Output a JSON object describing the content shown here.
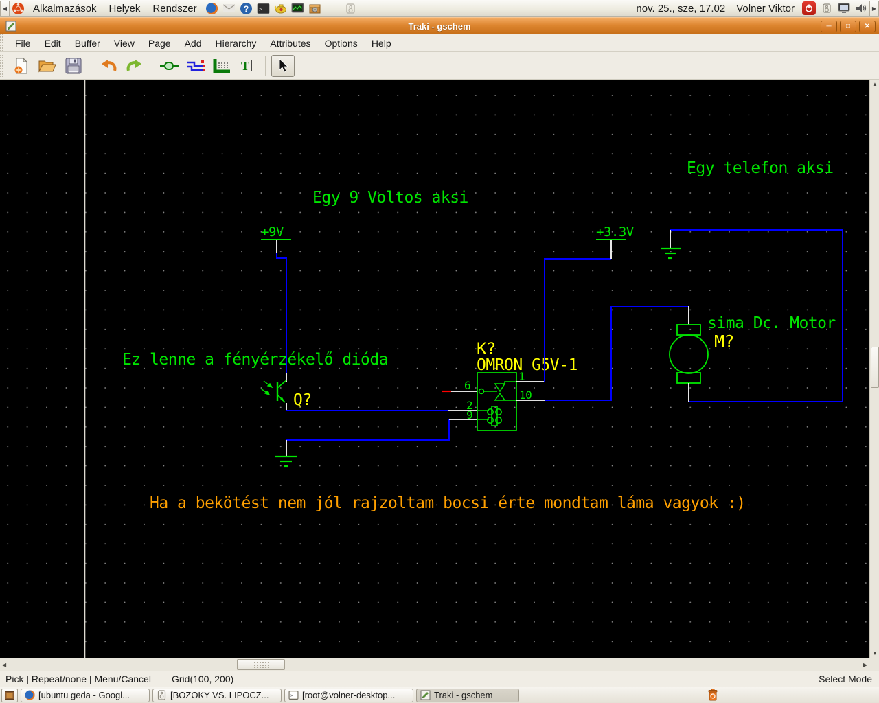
{
  "gnome_panel": {
    "menus": [
      "Alkalmazások",
      "Helyek",
      "Rendszer"
    ],
    "launcher_icons": [
      "firefox-icon",
      "mail-icon",
      "help-icon",
      "terminal-icon",
      "lamp-icon",
      "system-monitor-icon",
      "package-icon",
      "speaker-muted-icon"
    ],
    "clock": "nov. 25., sze, 17.02",
    "user": "Volner Viktor",
    "tray_icons": [
      "power-icon",
      "speaker-icon",
      "display-icon",
      "volume-icon"
    ]
  },
  "window": {
    "title": "Traki - gschem",
    "controls": {
      "minimize": "─",
      "maximize": "□",
      "close": "✕"
    }
  },
  "menubar": {
    "items": [
      "File",
      "Edit",
      "Buffer",
      "View",
      "Page",
      "Add",
      "Hierarchy",
      "Attributes",
      "Options",
      "Help"
    ]
  },
  "toolbar": {
    "icons": [
      "new-file-icon",
      "open-file-icon",
      "save-file-icon",
      "undo-icon",
      "redo-icon",
      "add-component-icon",
      "add-net-icon",
      "add-bus-icon",
      "add-text-icon",
      "select-arrow-icon"
    ]
  },
  "schematic": {
    "notes": {
      "title_9v": "Egy 9 Voltos aksi",
      "title_phone": "Egy telefon aksi",
      "sensor_note": "Ez lenne a fényérzékelő dióda",
      "apology": "Ha a bekötést nem jól rajzoltam bocsi érte mondtam láma vagyok :)"
    },
    "symbols": {
      "power_9v": "+9V",
      "power_33v": "+3.3V",
      "transistor_ref": "Q?",
      "relay_ref": "K?",
      "relay_value": "OMRON G5V-1",
      "motor_label": "sima Dc. Motor",
      "motor_ref": "M?"
    },
    "pin_numbers": {
      "pin1": "1",
      "pin2": "2",
      "pin6": "6",
      "pin9": "9",
      "pin10": "10"
    },
    "colors": {
      "net": "#0000ff",
      "pin": "#ffffff",
      "component": "#00e600",
      "attribute": "#ffff00",
      "text": "#00e600",
      "note_orange": "#ffa000",
      "unconnected": "#ff0000",
      "grid_dot": "#8f8f8f",
      "page_border": "#dedbd2"
    }
  },
  "statusbar": {
    "left": "Pick | Repeat/none | Menu/Cancel",
    "grid": "Grid(100, 200)",
    "mode": "Select Mode"
  },
  "taskbar": {
    "items": [
      {
        "label": "[ubuntu geda - Googl...",
        "icon": "firefox-icon"
      },
      {
        "label": "[BOZOKY VS. LIPOCZ...",
        "icon": "speaker-icon"
      },
      {
        "label": "[root@volner-desktop...",
        "icon": "terminal-icon"
      },
      {
        "label": "Traki - gschem",
        "icon": "gschem-icon"
      }
    ]
  }
}
